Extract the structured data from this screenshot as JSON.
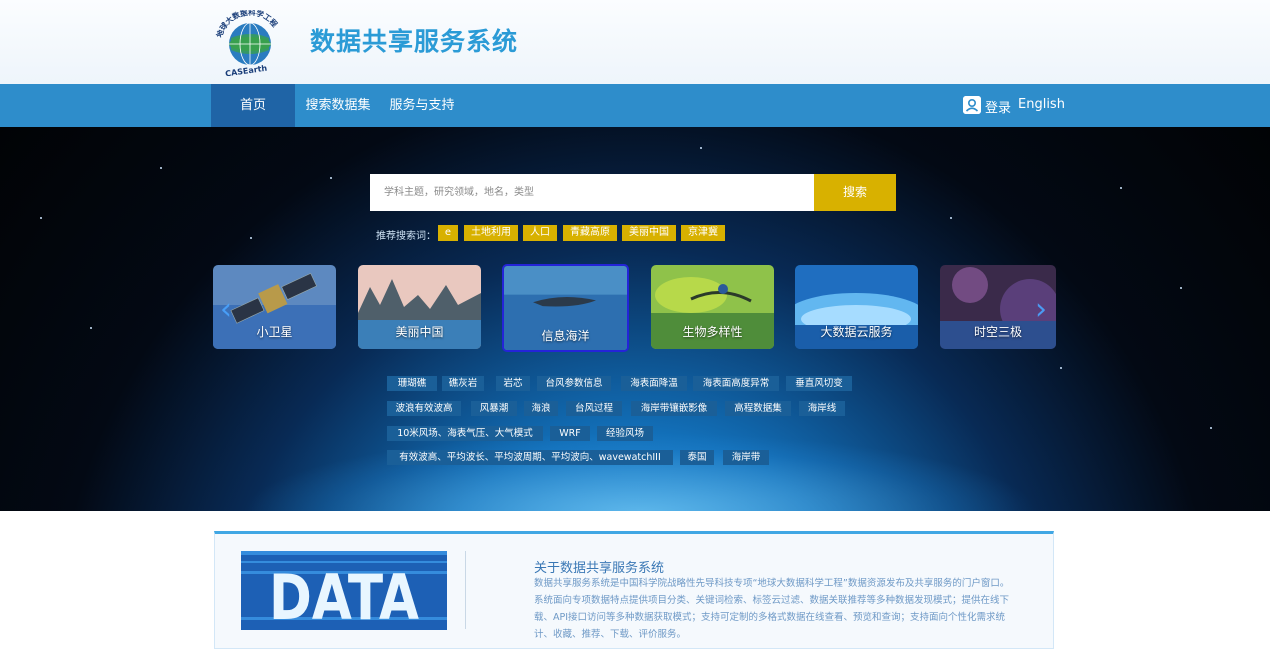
{
  "header": {
    "logo_arc_text": "地球大数据科学工程",
    "logo_bottom_text": "CASEarth",
    "title": "数据共享服务系统"
  },
  "nav": {
    "items": [
      {
        "label": "首页",
        "active": true
      },
      {
        "label": "搜索数据集",
        "active": false
      },
      {
        "label": "服务与支持",
        "active": false
      }
    ],
    "login_icon": "user-icon",
    "login": "登录",
    "language": "English"
  },
  "search": {
    "placeholder": "学科主题，研究领域，地名，类型",
    "button": "搜索",
    "recommend_label": "推荐搜索词：",
    "recommend_tags": [
      "e",
      "土地利用",
      "人口",
      "青藏高原",
      "美丽中国",
      "京津冀"
    ]
  },
  "carousel": {
    "prev_icon": "chevron-left-icon",
    "next_icon": "chevron-right-icon",
    "cards": [
      {
        "label": "小卫星",
        "selected": false
      },
      {
        "label": "美丽中国",
        "selected": false
      },
      {
        "label": "信息海洋",
        "selected": true
      },
      {
        "label": "生物多样性",
        "selected": false
      },
      {
        "label": "大数据云服务",
        "selected": false
      },
      {
        "label": "时空三极",
        "selected": false
      }
    ]
  },
  "keywords": [
    [
      "珊瑚礁",
      "礁灰岩",
      "岩芯",
      "台风参数信息",
      "海表面降温",
      "海表面高度异常",
      "垂直风切变"
    ],
    [
      "波浪有效波高",
      "风暴潮",
      "海浪",
      "台风过程",
      "海岸带镶嵌影像",
      "高程数据集",
      "海岸线"
    ],
    [
      "10米风场、海表气压、大气模式",
      "WRF",
      "经验风场"
    ],
    [
      "有效波高、平均波长、平均波周期、平均波向、wavewatchIII",
      "泰国",
      "海岸带"
    ]
  ],
  "about": {
    "image_text": "DATA",
    "title": "关于数据共享服务系统",
    "body": "数据共享服务系统是中国科学院战略性先导科技专项“地球大数据科学工程”数据资源发布及共享服务的门户窗口。系统面向专项数据特点提供项目分类、关键词检索、标签云过滤、数据关联推荐等多种数据发现模式；提供在线下载、API接口访问等多种数据获取模式；支持可定制的多格式数据在线查看、预览和查询；支持面向个性化需求统计、收藏、推荐、下载、评价服务。"
  },
  "colors": {
    "nav_bg": "#2e8dcb",
    "nav_active": "#1f64a6",
    "title_blue": "#2b9bd6",
    "search_button": "#d8b100",
    "keyword_tag": "#1a5f98",
    "card_selected_border": "#2424d8"
  }
}
